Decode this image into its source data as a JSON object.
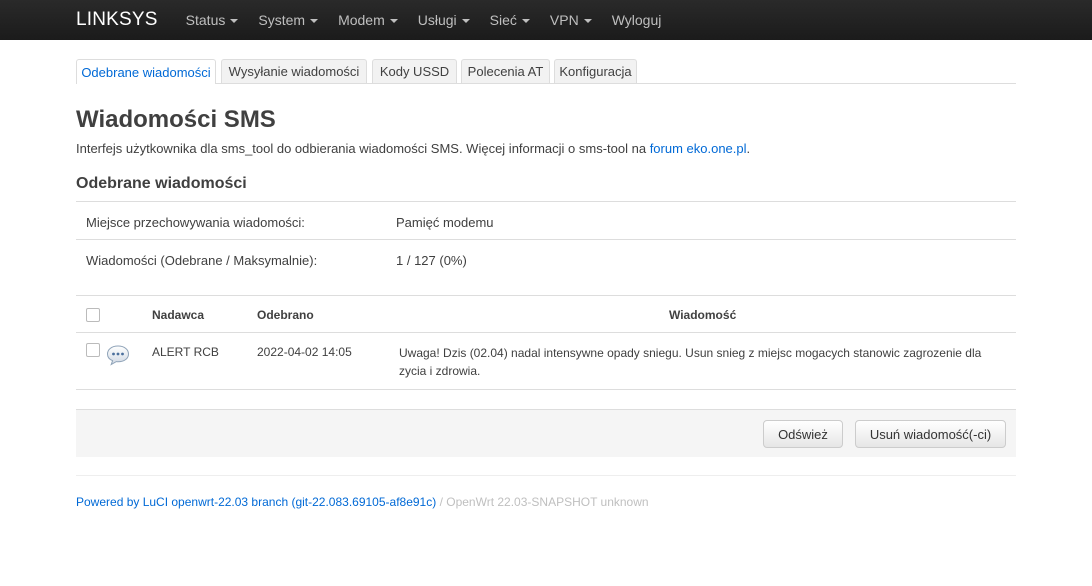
{
  "nav": {
    "brand": "LINKSYS",
    "items": [
      {
        "label": "Status",
        "dropdown": true
      },
      {
        "label": "System",
        "dropdown": true
      },
      {
        "label": "Modem",
        "dropdown": true
      },
      {
        "label": "Usługi",
        "dropdown": true
      },
      {
        "label": "Sieć",
        "dropdown": true
      },
      {
        "label": "VPN",
        "dropdown": true
      },
      {
        "label": "Wyloguj",
        "dropdown": false
      }
    ]
  },
  "tabs": [
    {
      "label": "Odebrane wiadomości",
      "active": true
    },
    {
      "label": "Wysyłanie wiadomości",
      "active": false
    },
    {
      "label": "Kody USSD",
      "active": false
    },
    {
      "label": "Polecenia AT",
      "active": false
    },
    {
      "label": "Konfiguracja",
      "active": false
    }
  ],
  "page": {
    "title": "Wiadomości SMS",
    "description_prefix": "Interfejs użytkownika dla sms_tool do odbierania wiadomości SMS. Więcej informacji o sms-tool na ",
    "description_link": "forum eko.one.pl",
    "description_suffix": "."
  },
  "section": {
    "title": "Odebrane wiadomości",
    "storage_label": "Miejsce przechowywania wiadomości:",
    "storage_value": "Pamięć modemu",
    "count_label": "Wiadomości (Odebrane / Maksymalnie):",
    "count_value": "1 / 127 (0%)"
  },
  "table": {
    "headers": {
      "sender": "Nadawca",
      "received": "Odebrano",
      "message": "Wiadomość"
    },
    "rows": [
      {
        "sender": "ALERT RCB",
        "received": "2022-04-02 14:05",
        "message": "Uwaga! Dzis (02.04) nadal intensywne opady sniegu. Usun snieg z miejsc mogacych stanowic zagrozenie dla zycia i zdrowia.",
        "icon": "chat-bubble-icon"
      }
    ]
  },
  "actions": {
    "refresh_label": "Odśwież",
    "delete_label": "Usuń wiadomość(-ci)"
  },
  "footer": {
    "link": "Powered by LuCI openwrt-22.03 branch (git-22.083.69105-af8e91c)",
    "separator": " / ",
    "version": "OpenWrt 22.03-SNAPSHOT unknown"
  }
}
